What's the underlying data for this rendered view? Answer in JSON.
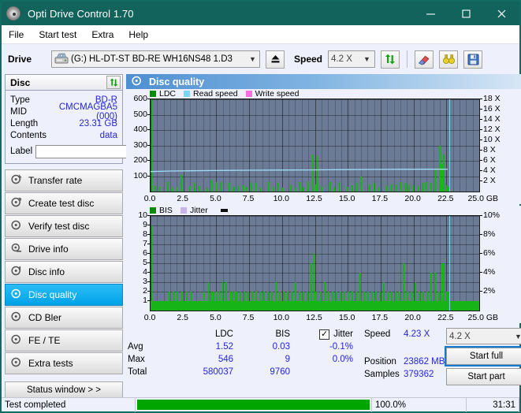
{
  "window": {
    "title": "Opti Drive Control 1.70",
    "icon": "disc-icon",
    "minimize": "–",
    "maximize": "□",
    "close": "✕"
  },
  "menu": [
    {
      "label": "File"
    },
    {
      "label": "Start test"
    },
    {
      "label": "Extra"
    },
    {
      "label": "Help"
    }
  ],
  "toolbar": {
    "drive_label": "Drive",
    "drive_value": "(G:)  HL-DT-ST BD-RE  WH16NS48 1.D3",
    "eject_icon": "eject-icon",
    "speed_label": "Speed",
    "speed_value": "4.2 X",
    "refresh_icon": "refresh-icon",
    "erase_icon": "eraser-icon",
    "inspect_icon": "binoculars-icon",
    "save_icon": "save-icon"
  },
  "disc": {
    "panel_title": "Disc",
    "refresh_icon": "refresh-icon",
    "rows": [
      {
        "key": "Type",
        "value": "BD-R"
      },
      {
        "key": "MID",
        "value": "CMCMAGBA5 (000)"
      },
      {
        "key": "Length",
        "value": "23.31 GB"
      },
      {
        "key": "Contents",
        "value": "data"
      }
    ],
    "label_key": "Label",
    "label_value": "",
    "label_button_icon": "disc-icon"
  },
  "sidebar": {
    "items": [
      {
        "label": "Transfer rate",
        "icon": "disc-icon",
        "active": false
      },
      {
        "label": "Create test disc",
        "icon": "disc-icon",
        "active": false
      },
      {
        "label": "Verify test disc",
        "icon": "disc-icon",
        "active": false
      },
      {
        "label": "Drive info",
        "icon": "disc-icon",
        "active": false
      },
      {
        "label": "Disc info",
        "icon": "disc-icon",
        "active": false
      },
      {
        "label": "Disc quality",
        "icon": "disc-icon",
        "active": true
      },
      {
        "label": "CD Bler",
        "icon": "disc-icon",
        "active": false
      },
      {
        "label": "FE / TE",
        "icon": "disc-icon",
        "active": false
      },
      {
        "label": "Extra tests",
        "icon": "disc-icon",
        "active": false
      }
    ],
    "status_window": "Status window > >"
  },
  "content": {
    "header_title": "Disc quality",
    "header_icon": "disc-icon"
  },
  "chart_data": [
    {
      "type": "bar",
      "title": "Disc quality - LDC",
      "legend": [
        {
          "label": "LDC",
          "color": "#0a8a0a"
        },
        {
          "label": "Read speed",
          "color": "#7fd4f5"
        },
        {
          "label": "Write speed",
          "color": "#ff6ee0"
        }
      ],
      "legend_position": "top-left",
      "xlabel": "GB",
      "x_ticks": [
        "0.0",
        "2.5",
        "5.0",
        "7.5",
        "10.0",
        "12.5",
        "15.0",
        "17.5",
        "20.0",
        "22.5",
        "25.0"
      ],
      "xlim": [
        0,
        25
      ],
      "ylabel": "",
      "y_ticks": [
        100,
        200,
        300,
        400,
        500,
        600
      ],
      "ylim": [
        0,
        600
      ],
      "y2_ticks": [
        "2 X",
        "4 X",
        "6 X",
        "8 X",
        "10 X",
        "12 X",
        "14 X",
        "16 X",
        "18 X"
      ],
      "y2lim": [
        0,
        18
      ],
      "grid": true,
      "series": [
        {
          "name": "LDC",
          "color": "#17b417",
          "x": [
            0.05,
            0.3,
            0.62,
            0.95,
            1.28,
            1.6,
            1.95,
            2.28,
            2.62,
            2.95,
            3.3,
            3.62,
            3.95,
            4.28,
            4.6,
            4.95,
            5.3,
            5.62,
            5.95,
            6.3,
            6.62,
            6.95,
            7.28,
            7.6,
            7.95,
            8.3,
            8.62,
            8.95,
            9.28,
            9.6,
            9.95,
            10.3,
            10.62,
            10.95,
            11.28,
            11.6,
            11.95,
            12.3,
            12.5,
            12.62,
            12.8,
            12.95,
            13.3,
            13.62,
            13.95,
            14.3,
            14.62,
            14.95,
            15.3,
            15.62,
            15.95,
            16.3,
            16.62,
            16.95,
            17.3,
            17.62,
            17.95,
            18.3,
            18.62,
            18.95,
            19.3,
            19.62,
            19.95,
            20.3,
            20.62,
            20.95,
            21.3,
            21.62,
            21.95,
            22.1,
            22.25,
            22.4,
            22.5,
            22.6,
            22.7
          ],
          "y": [
            600,
            35,
            30,
            30,
            60,
            28,
            30,
            110,
            30,
            35,
            62,
            35,
            95,
            25,
            70,
            60,
            62,
            30,
            55,
            30,
            35,
            40,
            30,
            62,
            55,
            28,
            35,
            60,
            30,
            58,
            25,
            30,
            40,
            28,
            60,
            30,
            65,
            240,
            45,
            230,
            40,
            30,
            48,
            60,
            30,
            62,
            52,
            30,
            40,
            60,
            100,
            30,
            45,
            62,
            30,
            60,
            35,
            45,
            40,
            60,
            55,
            40,
            42,
            35,
            58,
            60,
            58,
            140,
            300,
            180,
            240,
            58,
            40,
            30,
            35
          ]
        },
        {
          "name": "Read speed",
          "color": "#9fdcf8",
          "type": "line",
          "x": [
            0,
            1.5,
            3,
            4.5,
            6,
            7.5,
            9,
            10.5,
            12,
            13.5,
            15,
            16.5,
            18,
            19.5,
            21,
            22.6
          ],
          "y_x_units": [
            3.9,
            4.0,
            4.05,
            4.1,
            4.12,
            4.15,
            4.18,
            4.2,
            4.22,
            4.25,
            4.28,
            4.3,
            4.32,
            4.34,
            4.35,
            4.36
          ]
        }
      ],
      "end_marker": {
        "x": 22.72,
        "color": "#7fd4f5"
      }
    },
    {
      "type": "bar",
      "title": "Disc quality - BIS",
      "legend": [
        {
          "label": "BIS",
          "color": "#0a8a0a"
        },
        {
          "label": "Jitter",
          "color": "#c9b5e8"
        }
      ],
      "legend_position": "top-left",
      "xlabel": "GB",
      "x_ticks": [
        "0.0",
        "2.5",
        "5.0",
        "7.5",
        "10.0",
        "12.5",
        "15.0",
        "17.5",
        "20.0",
        "22.5",
        "25.0"
      ],
      "xlim": [
        0,
        25
      ],
      "y_ticks": [
        1,
        2,
        3,
        4,
        5,
        6,
        7,
        8,
        9,
        10
      ],
      "ylim": [
        0,
        10
      ],
      "y2_ticks": [
        "2%",
        "4%",
        "6%",
        "8%",
        "10%"
      ],
      "y2lim": [
        0,
        10
      ],
      "grid": true,
      "series": [
        {
          "name": "BIS",
          "color": "#17b417",
          "baseline": 1,
          "x": [
            0.05,
            0.35,
            0.7,
            1.05,
            1.4,
            1.7,
            2.0,
            2.35,
            2.7,
            3.0,
            3.35,
            3.7,
            4.0,
            4.35,
            4.6,
            4.75,
            5.0,
            5.2,
            5.45,
            5.7,
            6.0,
            6.2,
            6.35,
            6.5,
            6.8,
            7.1,
            7.4,
            7.7,
            8.0,
            8.3,
            8.6,
            8.9,
            9.2,
            9.5,
            9.8,
            10.1,
            10.4,
            10.7,
            11.0,
            11.3,
            11.6,
            11.9,
            12.2,
            12.4,
            12.55,
            12.7,
            12.9,
            13.2,
            13.5,
            13.8,
            14.1,
            14.4,
            14.7,
            15.0,
            15.3,
            15.6,
            15.9,
            16.2,
            16.5,
            16.8,
            17.1,
            17.4,
            17.7,
            18.0,
            18.3,
            18.6,
            18.9,
            19.2,
            19.5,
            19.8,
            20.1,
            20.4,
            20.7,
            21.0,
            21.3,
            21.6,
            21.9,
            22.1,
            22.25,
            22.4,
            22.5,
            22.6,
            22.68
          ],
          "y": [
            9,
            2,
            2,
            2,
            2,
            2,
            2,
            2,
            2,
            2,
            2,
            2,
            2,
            3,
            2,
            2,
            2,
            2,
            3,
            3,
            2,
            2,
            2,
            2,
            2,
            2,
            2,
            2,
            2,
            2,
            2,
            2,
            2,
            3,
            2,
            2,
            2,
            2,
            3,
            2,
            2,
            2,
            5,
            6,
            2,
            6,
            2,
            3,
            2,
            2,
            2,
            2,
            2,
            2,
            2,
            2,
            4,
            2,
            2,
            2,
            2,
            2,
            3,
            2,
            2,
            2,
            2,
            5,
            2,
            2,
            3,
            2,
            2,
            2,
            4,
            4,
            2,
            5,
            5,
            5,
            2,
            2,
            2
          ]
        }
      ],
      "end_marker": {
        "x": 22.72,
        "color": "#7fd4f5"
      }
    }
  ],
  "stats": {
    "headers": {
      "ldc": "LDC",
      "bis": "BIS",
      "jitter": "Jitter"
    },
    "jitter_checked": true,
    "jitter_check_glyph": "✓",
    "rows": [
      {
        "label": "Avg",
        "ldc": "1.52",
        "bis": "0.03",
        "jitter": "-0.1%"
      },
      {
        "label": "Max",
        "ldc": "546",
        "bis": "9",
        "jitter": "0.0%"
      },
      {
        "label": "Total",
        "ldc": "580037",
        "bis": "9760",
        "jitter": ""
      }
    ]
  },
  "readout": {
    "speed_key": "Speed",
    "speed_value": "4.23 X",
    "position_key": "Position",
    "position_value": "23862 MB",
    "samples_key": "Samples",
    "samples_value": "379362",
    "speed_select": "4.2 X",
    "start_full": "Start full",
    "start_part": "Start part"
  },
  "statusbar": {
    "message": "Test completed",
    "progress_percent": 100.0,
    "progress_text": "100.0%",
    "elapsed": "31:31"
  }
}
